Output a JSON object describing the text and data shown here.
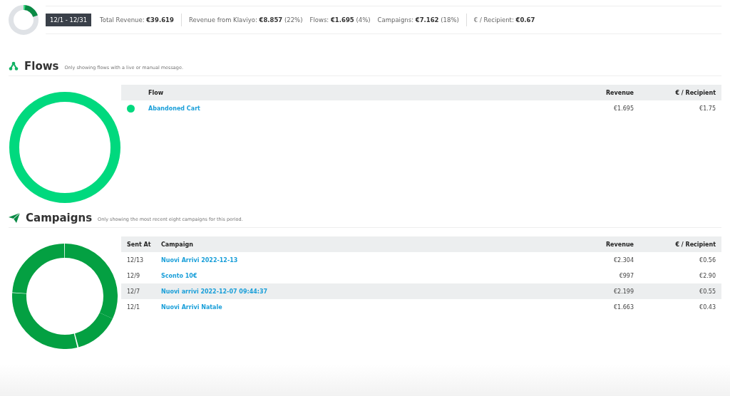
{
  "summary": {
    "date_range": "12/1 - 12/31",
    "metrics": [
      {
        "label": "Total Revenue:",
        "value": "€39.619",
        "divider_after": true
      },
      {
        "label": "Revenue from Klaviyo:",
        "value": "€8.857",
        "share": "(22%)",
        "divider_after": false
      },
      {
        "label": "Flows:",
        "value": "€1.695",
        "share": "(4%)",
        "divider_after": false
      },
      {
        "label": "Campaigns:",
        "value": "€7.162",
        "share": "(18%)",
        "divider_after": true
      },
      {
        "label": "€ / Recipient:",
        "value": "€0.67",
        "divider_after": false
      }
    ]
  },
  "flows": {
    "title": "Flows",
    "note": "Only showing flows with a live or manual message.",
    "columns": [
      "Flow",
      "Revenue",
      "€ / Recipient"
    ],
    "rows": [
      {
        "color": "#00d97e",
        "flow": "Abandoned Cart",
        "revenue": "€1.695",
        "per_recipient": "€1.75"
      }
    ]
  },
  "campaigns": {
    "title": "Campaigns",
    "note": "Only showing the most recent eight campaigns for this period.",
    "columns": [
      "Sent At",
      "Campaign",
      "Revenue",
      "€ / Recipient"
    ],
    "rows": [
      {
        "sent_at": "12/13",
        "campaign": "Nuovi Arrivi 2022-12-13",
        "revenue": "€2.304",
        "per_recipient": "€0.56"
      },
      {
        "sent_at": "12/9",
        "campaign": "Sconto 10€",
        "revenue": "€997",
        "per_recipient": "€2.90"
      },
      {
        "sent_at": "12/7",
        "campaign": "Nuovi arrivi 2022-12-07 09:44:37",
        "revenue": "€2.199",
        "per_recipient": "€0.55"
      },
      {
        "sent_at": "12/1",
        "campaign": "Nuovi Arrivi Natale",
        "revenue": "€1.663",
        "per_recipient": "€0.43"
      }
    ]
  }
}
